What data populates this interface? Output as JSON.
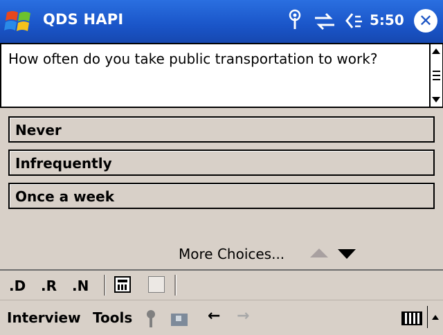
{
  "titlebar": {
    "app_title": "QDS HAPI",
    "time": "5:50",
    "close_label": "✕",
    "icons": [
      "windows-start-icon",
      "antenna-icon",
      "connectivity-sync-icon",
      "speaker-icon",
      "close-icon"
    ]
  },
  "question": {
    "text": "How often do you take public transportation to work?"
  },
  "choices": [
    {
      "label": "Never"
    },
    {
      "label": "Infrequently"
    },
    {
      "label": "Once a week"
    }
  ],
  "pager": {
    "more_choices_label": "More Choices..."
  },
  "toolbar": {
    "d_label": ".D",
    "r_label": ".R",
    "n_label": ".N"
  },
  "menubar": {
    "interview_label": "Interview",
    "tools_label": "Tools",
    "back_icon": "←",
    "forward_icon": "→"
  },
  "colors": {
    "titlebar": "#1a55c8",
    "background": "#d8d0c8",
    "question_bg": "#ffffff"
  }
}
